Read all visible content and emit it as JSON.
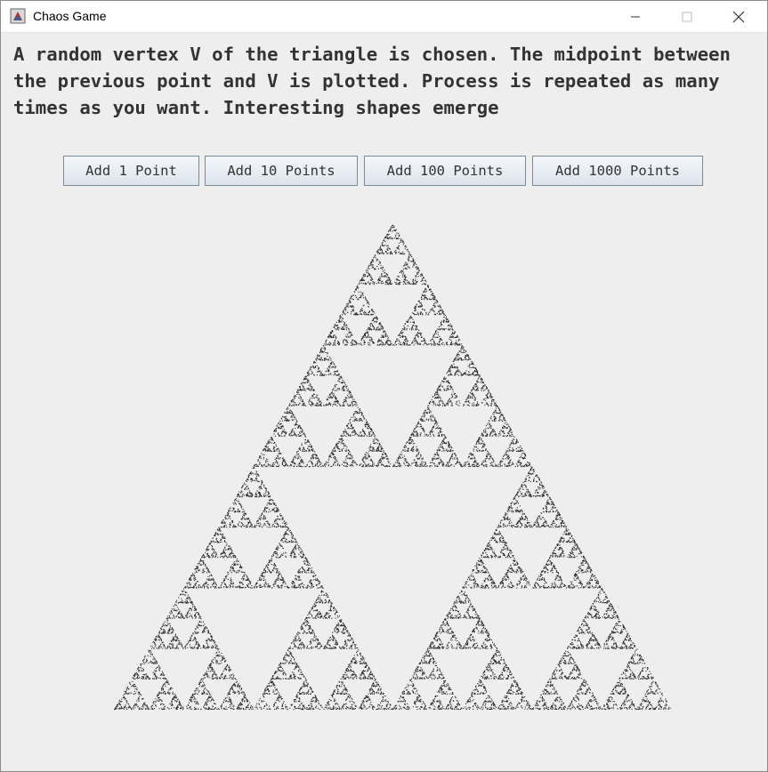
{
  "window": {
    "title": "Chaos Game",
    "icon": "java-app-icon",
    "controls": [
      "minimize-icon",
      "maximize-icon",
      "close-icon"
    ]
  },
  "description": "A random vertex V of the triangle is chosen. The midpoint between the previous point and V is plotted. Process is repeated as many times as you want. Interesting shapes emerge",
  "buttons": {
    "add_1": "Add 1 Point",
    "add_10": "Add 10 Points",
    "add_100": "Add 100 Points",
    "add_1000": "Add 1000 Points"
  },
  "plot": {
    "point_color": "#2a2a2a"
  }
}
